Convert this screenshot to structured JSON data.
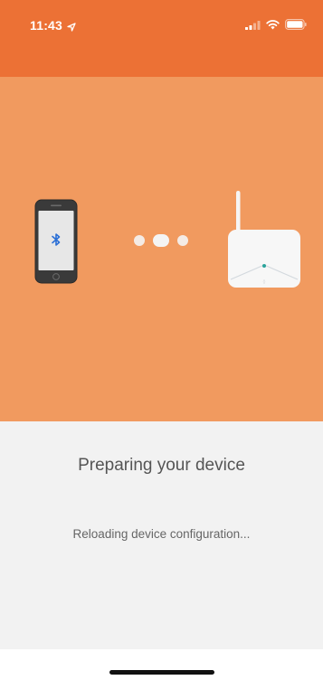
{
  "status_bar": {
    "time": "11:43",
    "location_icon": "location-arrow-icon",
    "signal_icon": "cellular-signal-icon",
    "wifi_icon": "wifi-icon",
    "battery_icon": "battery-icon"
  },
  "illustration": {
    "phone_icon": "smartphone-icon",
    "bluetooth_icon": "bluetooth-icon",
    "router_icon": "router-icon",
    "progress_dots": 3,
    "active_dot": 2
  },
  "content": {
    "title": "Preparing your device",
    "subtitle": "Reloading device configuration..."
  },
  "colors": {
    "header": "#EC7135",
    "illustration_bg": "#F19A5F",
    "content_bg": "#F2F2F2",
    "title_text": "#555555",
    "subtitle_text": "#666666",
    "dot": "#F4F4F4",
    "home_indicator": "#111111"
  }
}
